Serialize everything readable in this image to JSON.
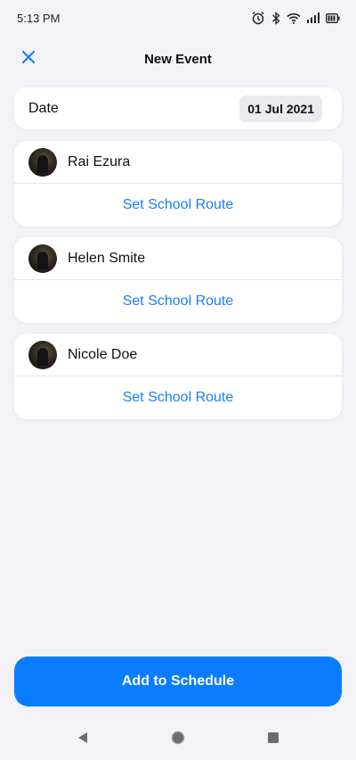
{
  "status_bar": {
    "time": "5:13 PM"
  },
  "header": {
    "title": "New Event"
  },
  "date_row": {
    "label": "Date",
    "value": "01 Jul 2021"
  },
  "people": [
    {
      "name": "Rai Ezura",
      "action": "Set School Route"
    },
    {
      "name": "Helen Smite",
      "action": "Set School Route"
    },
    {
      "name": "Nicole Doe",
      "action": "Set School Route"
    }
  ],
  "primary_action": {
    "label": "Add to Schedule"
  },
  "colors": {
    "accent": "#0a7cff",
    "link": "#1a7ff0",
    "background": "#f2f2f7",
    "card": "#ffffff"
  },
  "icons": {
    "close": "close-icon",
    "alarm": "alarm-icon",
    "bluetooth": "bluetooth-icon",
    "wifi": "wifi-icon",
    "signal": "signal-icon",
    "battery": "battery-icon",
    "back": "back-icon",
    "home": "home-icon",
    "recents": "recents-icon"
  }
}
